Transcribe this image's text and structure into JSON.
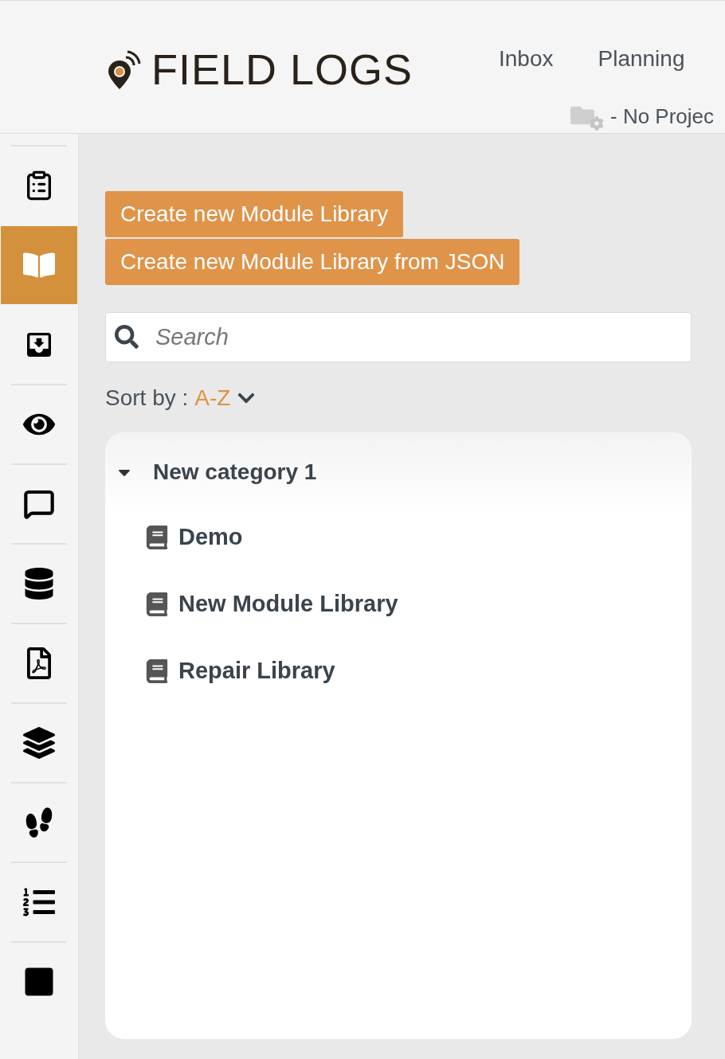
{
  "header": {
    "logo": "FIELD LOGS",
    "nav": [
      {
        "label": "Inbox"
      },
      {
        "label": "Planning"
      }
    ],
    "project": "- No Projec"
  },
  "sidebar": {
    "items": [
      {
        "selected": false
      },
      {
        "selected": true
      },
      {
        "selected": false
      },
      {
        "selected": false
      },
      {
        "selected": false
      },
      {
        "selected": false
      },
      {
        "selected": false
      },
      {
        "selected": false
      },
      {
        "selected": false
      },
      {
        "selected": false
      },
      {
        "selected": false
      }
    ]
  },
  "page": {
    "buttons": [
      "Create new Module Library",
      "Create new Module Library from JSON"
    ],
    "search": {
      "placeholder": "Search"
    },
    "sort": {
      "label": "Sort by :",
      "value": "A-Z"
    }
  },
  "tree": [
    {
      "label": "New category 1",
      "expanded": true,
      "children": [
        {
          "label": "Demo"
        },
        {
          "label": "New Module Library"
        },
        {
          "label": "Repair Library"
        }
      ]
    }
  ]
}
